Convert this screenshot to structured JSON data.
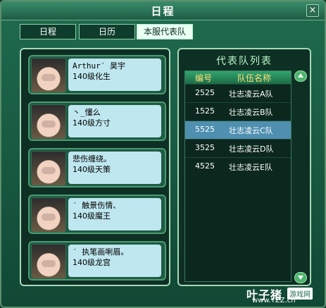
{
  "window": {
    "title": "日程",
    "close_symbol": "×"
  },
  "tabs": [
    {
      "label": "日程",
      "active": false
    },
    {
      "label": "日历",
      "active": false
    },
    {
      "label": "本服代表队",
      "active": true
    }
  ],
  "team_members": [
    {
      "name": "Arthur′ 昊宇",
      "level": "140级化生"
    },
    {
      "name": "丶_懂么",
      "level": "140级方寸"
    },
    {
      "name": "悲伤缠绕。",
      "level": "140级天策"
    },
    {
      "name": "′ 触景伤情、",
      "level": "140级魔王"
    },
    {
      "name": "′ 执笔画唎眉。",
      "level": "140级龙宫"
    }
  ],
  "team_list": {
    "title": "代表队列表",
    "headers": [
      "编号",
      "队伍名称"
    ],
    "rows": [
      {
        "id": "2525",
        "name": "壮志凌云A队",
        "selected": false
      },
      {
        "id": "1525",
        "name": "壮志凌云B队",
        "selected": false
      },
      {
        "id": "5525",
        "name": "壮志凌云C队",
        "selected": true
      },
      {
        "id": "3525",
        "name": "壮志凌云D队",
        "selected": false
      },
      {
        "id": "4525",
        "name": "壮志凌云E队",
        "selected": false
      }
    ]
  },
  "watermark": {
    "brand": "叶子猪",
    "tag": "游戏网",
    "url": "www.YZZ.cn"
  }
}
